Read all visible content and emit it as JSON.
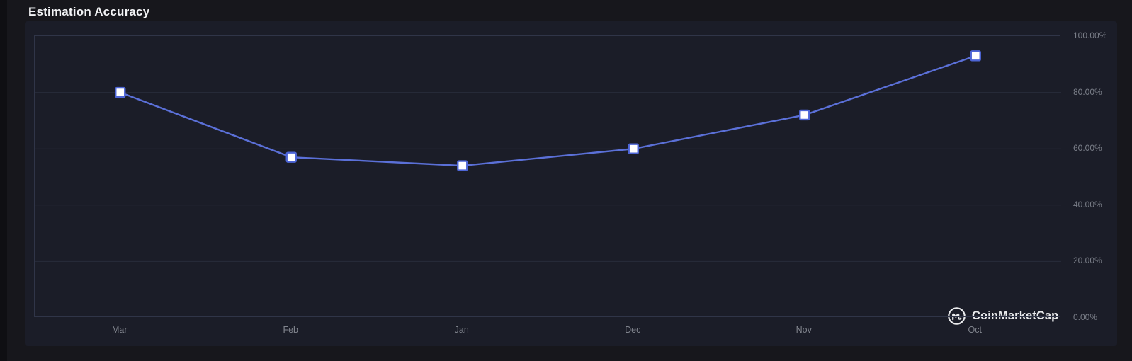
{
  "page": {
    "title": "Estimation Accuracy"
  },
  "watermark": {
    "label": "CoinMarketCap"
  },
  "colors": {
    "background": "#17171c",
    "panel": "#1b1d28",
    "plot_border": "#303548",
    "gridline": "#282c3a",
    "axis_label": "#7b7f89",
    "line": "#5b70d8",
    "marker_border": "#4d65d6",
    "marker_fill": "#ffffff",
    "title_text": "#f2f3f5",
    "watermark_text": "#e9eaec"
  },
  "chart_data": {
    "type": "line",
    "title": "Estimation Accuracy",
    "categories": [
      "Mar",
      "Feb",
      "Jan",
      "Dec",
      "Nov",
      "Oct"
    ],
    "series": [
      {
        "name": "Estimation Accuracy",
        "values": [
          80,
          57,
          54,
          60,
          72,
          93
        ]
      }
    ],
    "xlabel": "",
    "ylabel": "",
    "ylim": [
      0,
      100
    ],
    "y_tick_interval": 20,
    "y_tick_labels": [
      "100.00%",
      "80.00%",
      "60.00%",
      "40.00%",
      "20.00%",
      "0.00%"
    ],
    "grid": "horizontal-only",
    "legend": "none",
    "marker": "square",
    "y_axis_side": "right"
  }
}
